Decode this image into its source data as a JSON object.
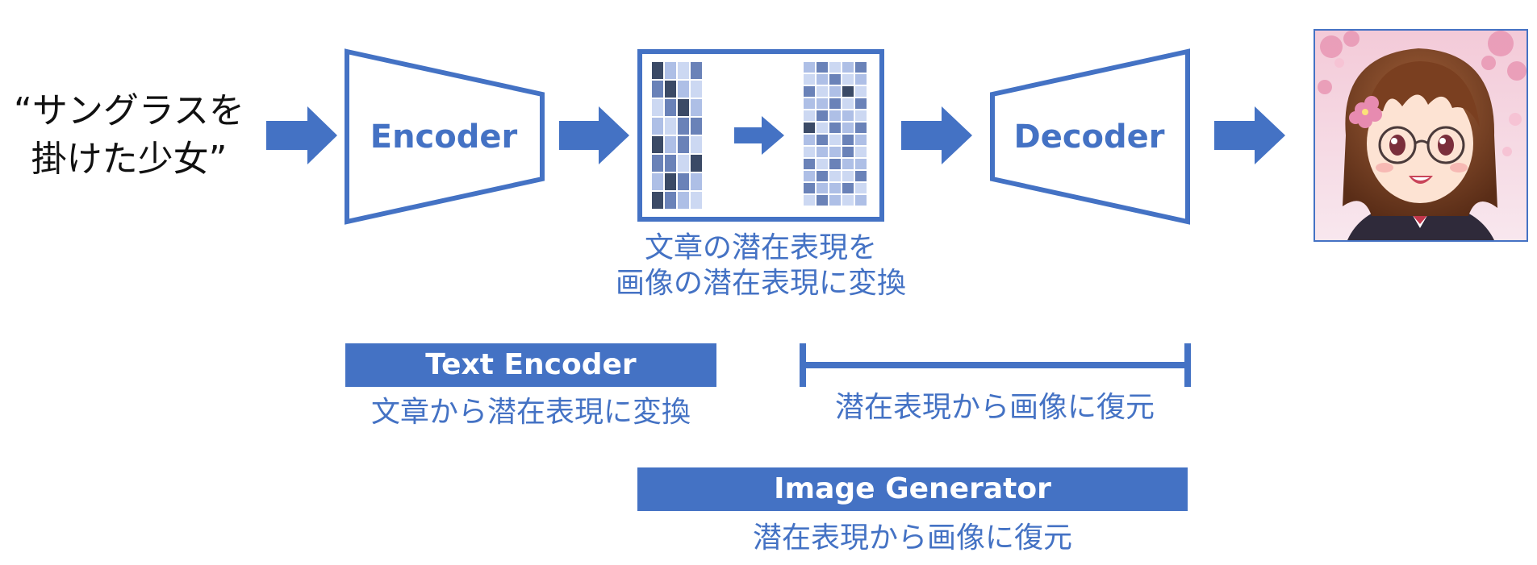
{
  "prompt": {
    "line1": "“サングラスを",
    "line2": "掛けた少女”"
  },
  "encoder_label": "Encoder",
  "decoder_label": "Decoder",
  "latent_caption": {
    "line1": "文章の潜在表現を",
    "line2": "画像の潜在表現に変換"
  },
  "text_encoder": {
    "title": "Text Encoder",
    "caption": "文章から潜在表現に変換"
  },
  "decoder_bracket_caption": "潜在表現から画像に復元",
  "image_generator": {
    "title": "Image Generator",
    "caption": "潜在表現から画像に復元"
  },
  "colors": {
    "accent": "#4472c4",
    "text_dark": "#111111",
    "cell_dark": "#3b4a66",
    "cell_mid": "#6a82b8",
    "cell_light": "#aebfe6",
    "cell_pale": "#ccd8f2"
  },
  "output_image": {
    "alt": "anime illustration of a smiling girl wearing round glasses with cherry blossoms"
  }
}
